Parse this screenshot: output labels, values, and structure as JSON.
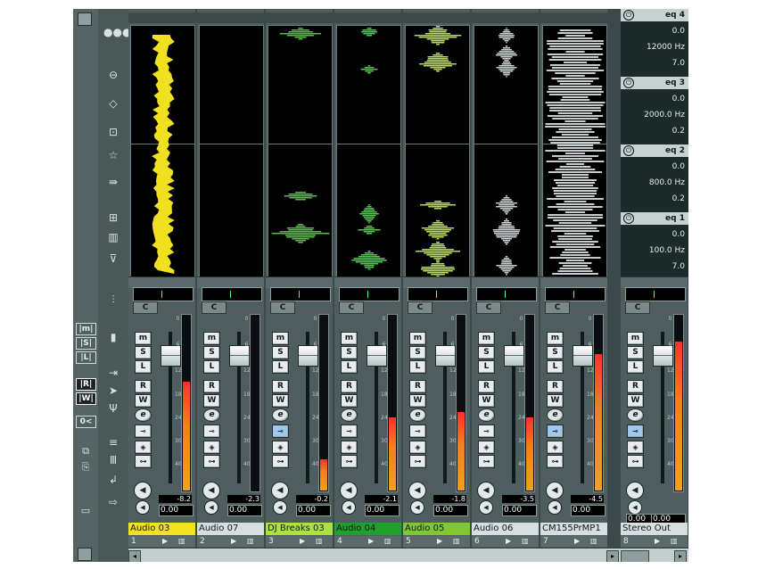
{
  "tracks": [
    {
      "name": "Audio 03",
      "num": "1",
      "peak": "-8.2",
      "vol": "0.00",
      "color": "#f3e020",
      "meter": 0.62,
      "fader": 0.15
    },
    {
      "name": "Audio 07",
      "num": "2",
      "peak": "-2.3",
      "vol": "0.00",
      "color": "#d6dede",
      "meter": 0.0,
      "fader": 0.15
    },
    {
      "name": "DJ Breaks 03",
      "num": "3",
      "peak": "-0.2",
      "vol": "0.00",
      "color": "#aee040",
      "meter": 0.18,
      "fader": 0.15
    },
    {
      "name": "Audio 04",
      "num": "4",
      "peak": "-2.1",
      "vol": "0.00",
      "color": "#1ea22c",
      "meter": 0.42,
      "fader": 0.15
    },
    {
      "name": "Audio 05",
      "num": "5",
      "peak": "-1.8",
      "vol": "0.00",
      "color": "#80c830",
      "meter": 0.45,
      "fader": 0.15
    },
    {
      "name": "Audio 06",
      "num": "6",
      "peak": "-3.5",
      "vol": "0.00",
      "color": "#d6dede",
      "meter": 0.42,
      "fader": 0.15
    },
    {
      "name": "CM155PrMP1",
      "num": "7",
      "peak": "-4.5",
      "vol": "0.00",
      "color": "#d6dede",
      "meter": 0.78,
      "fader": 0.15
    }
  ],
  "buttons": {
    "mute": "m",
    "solo": "S",
    "listen": "L",
    "read": "R",
    "write": "W",
    "edit": "e",
    "pan": "C"
  },
  "stereo": {
    "name": "Stereo Out",
    "num": "8",
    "vol_l": "0.00",
    "vol": "0.00",
    "meter": 0.85
  },
  "scale_marks": [
    "0",
    "6",
    "12",
    "18",
    "24",
    "30",
    "40"
  ],
  "eq": [
    {
      "title": "eq 4",
      "gain": "0.0",
      "freq": "12000 Hz",
      "q": "7.0"
    },
    {
      "title": "eq 3",
      "gain": "0.0",
      "freq": "2000.0 Hz",
      "q": "0.2"
    },
    {
      "title": "eq 2",
      "gain": "0.0",
      "freq": "800.0 Hz",
      "q": "0.2"
    },
    {
      "title": "eq 1",
      "gain": "0.0",
      "freq": "100.0 Hz",
      "q": "7.0"
    }
  ],
  "left_toggles": [
    {
      "label": "|m|",
      "on": false
    },
    {
      "label": "|S|",
      "on": false
    },
    {
      "label": "|L|",
      "on": false
    },
    {
      "label": "|R|",
      "on": true
    },
    {
      "label": "|W|",
      "on": true
    }
  ],
  "left_icons": [
    "●●●",
    "⊖",
    "◇",
    "⊡",
    "☆",
    "⇛",
    "⊞",
    "▥",
    "⊽"
  ],
  "misc": {
    "left_icon_top": "●●●"
  }
}
